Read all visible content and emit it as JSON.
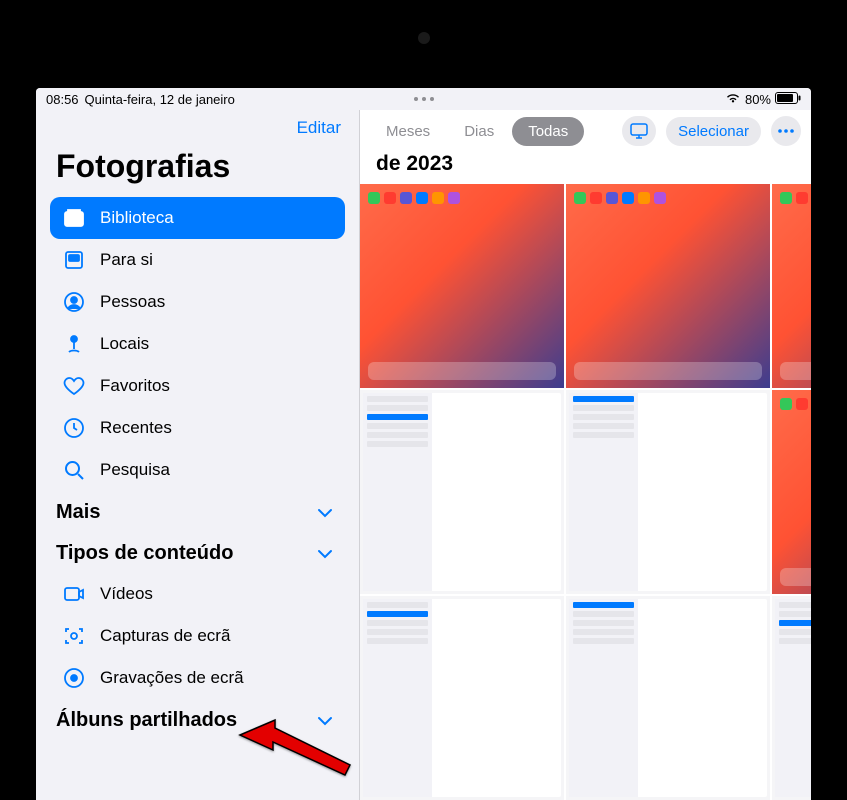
{
  "status": {
    "time": "08:56",
    "date": "Quinta-feira, 12 de janeiro",
    "battery": "80%"
  },
  "sidebar": {
    "edit": "Editar",
    "title": "Fotografias",
    "items": [
      {
        "label": "Biblioteca"
      },
      {
        "label": "Para si"
      },
      {
        "label": "Pessoas"
      },
      {
        "label": "Locais"
      },
      {
        "label": "Favoritos"
      },
      {
        "label": "Recentes"
      },
      {
        "label": "Pesquisa"
      }
    ],
    "sections": {
      "more": "Mais",
      "content_types": "Tipos de conteúdo",
      "shared_albums": "Álbuns partilhados"
    },
    "content_items": [
      {
        "label": "Vídeos"
      },
      {
        "label": "Capturas de ecrã"
      },
      {
        "label": "Gravações de ecrã"
      }
    ]
  },
  "main": {
    "tabs": [
      {
        "label": "Meses"
      },
      {
        "label": "Dias"
      },
      {
        "label": "Todas"
      }
    ],
    "select": "Selecionar",
    "title": "de 2023"
  }
}
